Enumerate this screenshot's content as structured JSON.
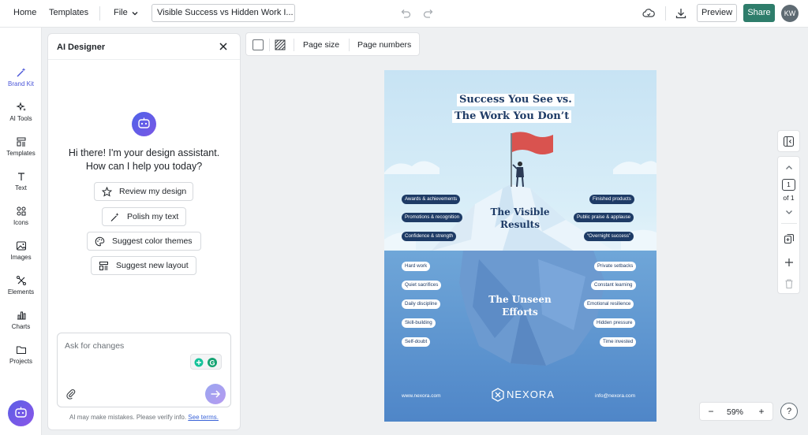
{
  "topbar": {
    "home": "Home",
    "templates": "Templates",
    "file": "File",
    "doc_title": "Visible Success vs Hidden Work I...",
    "preview": "Preview",
    "share": "Share",
    "avatar": "KW",
    "share_color": "#2e7d6b"
  },
  "rail": {
    "items": [
      {
        "label": "Brand Kit",
        "icon": "magic-wand-icon",
        "active": true
      },
      {
        "label": "AI Tools",
        "icon": "sparkles-icon"
      },
      {
        "label": "Templates",
        "icon": "templates-icon"
      },
      {
        "label": "Text",
        "icon": "text-icon"
      },
      {
        "label": "Icons",
        "icon": "icons-icon"
      },
      {
        "label": "Images",
        "icon": "image-icon"
      },
      {
        "label": "Elements",
        "icon": "elements-icon"
      },
      {
        "label": "Charts",
        "icon": "bar-chart-icon"
      },
      {
        "label": "Projects",
        "icon": "folder-icon"
      }
    ]
  },
  "ai_panel": {
    "title": "AI Designer",
    "greeting_line1": "Hi there! I'm your design assistant.",
    "greeting_line2": "How can I help you today?",
    "suggestions": [
      {
        "label": "Review my design",
        "icon": "star-icon"
      },
      {
        "label": "Polish my text",
        "icon": "magic-wand-icon"
      },
      {
        "label": "Suggest color themes",
        "icon": "palette-icon"
      },
      {
        "label": "Suggest new layout",
        "icon": "layout-icon"
      }
    ],
    "input_placeholder": "Ask for changes",
    "disclaimer": "AI may make mistakes. Please verify info.",
    "terms_link": "See terms."
  },
  "canvas_toolbar": {
    "page_size": "Page size",
    "page_numbers": "Page numbers"
  },
  "poster": {
    "title_line1": "Success You See vs.",
    "title_line2": "The Work You Don’t",
    "visible_heading_1": "The Visible",
    "visible_heading_2": "Results",
    "unseen_heading_1": "The Unseen",
    "unseen_heading_2": "Efforts",
    "visible_left": [
      "Awards & achievements",
      "Promotions & recognition",
      "Confidence & strength"
    ],
    "visible_right": [
      "Finished products",
      "Public praise & applause",
      "“Overnight success”"
    ],
    "unseen_left": [
      "Hard work",
      "Quiet sacrifices",
      "Daily discipline",
      "Skill-building",
      "Self-doubt"
    ],
    "unseen_right": [
      "Private setbacks",
      "Constant learning",
      "Emotional resilience",
      "Hidden pressure",
      "Time invested"
    ],
    "website": "www.nexora.com",
    "brand": "NEXORA",
    "email": "info@nexora.com",
    "navy": "#1e3b66",
    "flag_red": "#d9534f"
  },
  "page_nav": {
    "current": "1",
    "of_text": "of 1"
  },
  "zoom": {
    "value": "59%"
  }
}
